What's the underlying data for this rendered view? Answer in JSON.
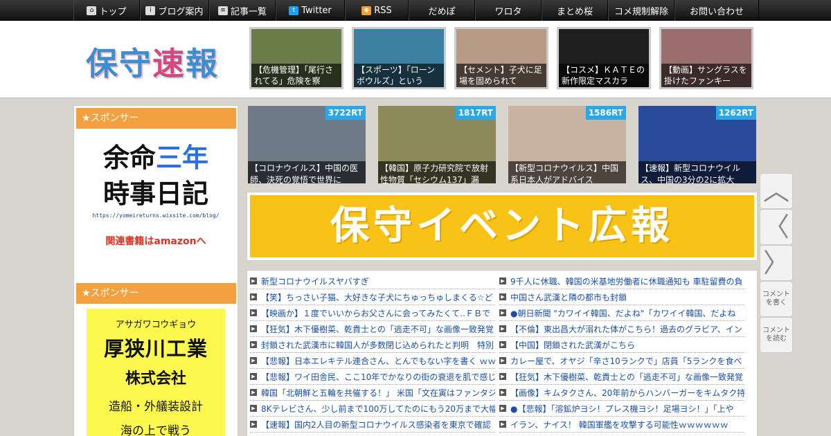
{
  "nav": [
    {
      "label": "トップ",
      "icon": "home-icon"
    },
    {
      "label": "ブログ案内",
      "icon": "info-icon"
    },
    {
      "label": "記事一覧",
      "icon": "list-icon"
    },
    {
      "label": "Twitter",
      "icon": "twitter-icon"
    },
    {
      "label": "RSS",
      "icon": "rss-icon"
    },
    {
      "label": "だめぽ"
    },
    {
      "label": "ワロタ"
    },
    {
      "label": "まとめ桜"
    },
    {
      "label": "コメ規制解除"
    },
    {
      "label": "お問い合わせ"
    }
  ],
  "logo": {
    "text": "保守速報"
  },
  "header_thumbs": [
    {
      "caption": "【危機管理】「尾行されてる」危険を察",
      "color": "#6b7d4a"
    },
    {
      "caption": "【スポーツ】「ローンボウルズ」という",
      "color": "#3c7fa0"
    },
    {
      "caption": "【セメント】子犬に足場を固められて",
      "color": "#b89b86"
    },
    {
      "caption": "【コスメ】ＫＡＴＥの新作限定マスカラ",
      "color": "#1e1e1e"
    },
    {
      "caption": "【動画】サングラスを掛けたファンキー",
      "color": "#9a6e6e"
    }
  ],
  "sidebar": {
    "sponsor1": {
      "title": "★スポンサー",
      "line1a": "余命",
      "line1b": "三年",
      "line2": "時事日記",
      "url": "https://yomeireturns.wixsite.com/blog/",
      "link": "関連書籍はamazonへ"
    },
    "sponsor2": {
      "title": "★スポンサー",
      "kana": "アサガワコウギョウ",
      "name": "厚狭川工業",
      "kk": "株式会社",
      "desc": "造船・外艤装設計",
      "more": "海の上で戦う"
    }
  },
  "rt_tiles": [
    {
      "rt": "3722RT",
      "caption": "【コロナウイルス】中国の医師、決死の覚悟で世界に",
      "color": "#6e7a86"
    },
    {
      "rt": "1817RT",
      "caption": "【韓国】原子力研究院で放射性物質「セシウム137」漏",
      "color": "#8c8a5a"
    },
    {
      "rt": "1586RT",
      "caption": "【新型コロナウイルス】中国系日本人がアドバイス",
      "color": "#c8b4a0"
    },
    {
      "rt": "1262RT",
      "caption": "【速報】新型コロナウイルス、中国の3分の2に拡大",
      "color": "#2a4a9a"
    }
  ],
  "banner": {
    "text": "保守イベント広報"
  },
  "list_left": [
    "新型コロナウイルスヤバすぎ",
    "【笑】ちっさい子猫、大好きな子犬にちゅっちゅしまくる☆ど",
    "【映画か】１度でいいからお父さんに会ってみたくて‥ＦＢで",
    "【狂気】木下優樹菜、乾貴士との「逃走不可」な画像一致発覚",
    "封鎖された武漢市に韓国人が多数閉じ込められたと判明　特別",
    "【悲報】日本エレキテル連合さん、とんでもない字を書く ｗｗ",
    "【悲報】ワイ田舎民、ここ10年でかなりの街の衰退を肌で感じ",
    "韓国「北朝鮮と五輪を共催する！」 米国「文在寅はファンタジ",
    "8Kテレビさん、少し前まで100万してたのにもう20万まで大幅値",
    "【速報】国内2人目の新型コロナウイルス感染者を東京で確認"
  ],
  "list_right": [
    "9千人に休職、韓国の米基地労働者に休職通知も 車駐留費の負",
    "中国さん武漢と隣の都市も封鎖",
    "●朝日新聞 \"カワイイ韓国、だよね\"「カワイイ韓国、だよね",
    "【不倫】東出昌大が溺れた体がこちら！過去のグラビア、イン",
    "【中国】閉鎖された武漢がこちら",
    "カレー屋で、オヤジ「辛さ10ランクで」店員「5ランクを食べ",
    "【狂気】木下優樹菜、乾貴士との「逃走不可」な画像一致発覚",
    "【画像】キムタクさん、20年前からハンバーガーをキムタク持",
    "●【悲報】「溶鉱炉ヨシ！プレス機ヨシ！足場ヨシ！」「上や",
    "イラン、ナイス！ 韓国軍艦を攻撃する可能性ｗｗｗｗｗｗ"
  ],
  "tools": [
    {
      "label": "",
      "icon": "chevron-up-icon"
    },
    {
      "label": "",
      "icon": "chevron-left-icon"
    },
    {
      "label": "",
      "icon": "chevron-right-icon"
    },
    {
      "label": "コメントを書く"
    },
    {
      "label": "コメントを読む"
    }
  ]
}
